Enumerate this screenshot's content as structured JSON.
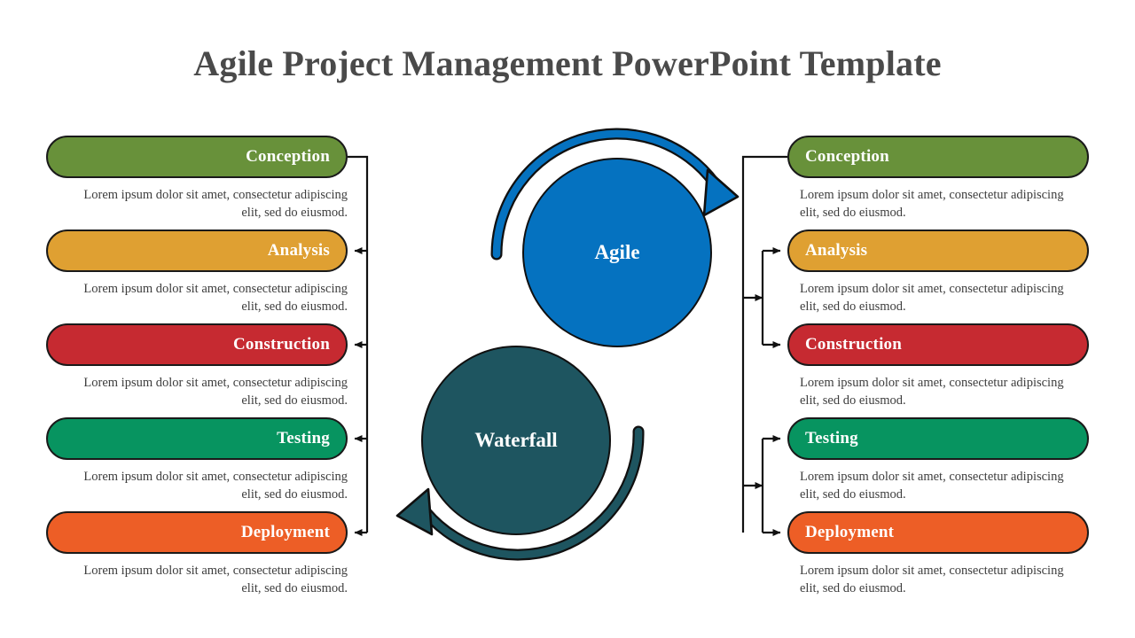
{
  "slide": {
    "title": "Agile Project Management PowerPoint Template",
    "background_color": "#ffffff",
    "title_color": "#4a4a4a"
  },
  "body_text": "Lorem ipsum dolor sit amet, consectetur adipiscing elit, sed do eiusmod.",
  "center": {
    "agile": {
      "label": "Agile",
      "color": "#0572c0",
      "arrow_direction": "clockwise-top"
    },
    "waterfall": {
      "label": "Waterfall",
      "color": "#1e5560",
      "arrow_direction": "counterclockwise-bottom"
    }
  },
  "left_column": {
    "align": "right",
    "items": [
      {
        "label": "Conception",
        "color": "#68913a",
        "desc": "Lorem ipsum dolor sit amet, consectetur adipiscing elit, sed do eiusmod."
      },
      {
        "label": "Analysis",
        "color": "#dfa032",
        "desc": "Lorem ipsum dolor sit amet, consectetur adipiscing elit, sed do eiusmod."
      },
      {
        "label": "Construction",
        "color": "#c62a31",
        "desc": "Lorem ipsum dolor sit amet, consectetur adipiscing elit, sed do eiusmod."
      },
      {
        "label": "Testing",
        "color": "#079460",
        "desc": "Lorem ipsum dolor sit amet, consectetur adipiscing elit, sed do eiusmod."
      },
      {
        "label": "Deployment",
        "color": "#ed5e26",
        "desc": "Lorem ipsum dolor sit amet, consectetur adipiscing elit, sed do eiusmod."
      }
    ]
  },
  "right_column": {
    "align": "left",
    "items": [
      {
        "label": "Conception",
        "color": "#68913a",
        "desc": "Lorem ipsum dolor sit amet, consectetur adipiscing elit, sed do eiusmod."
      },
      {
        "label": "Analysis",
        "color": "#dfa032",
        "desc": "Lorem ipsum dolor sit amet, consectetur adipiscing elit, sed do eiusmod."
      },
      {
        "label": "Construction",
        "color": "#c62a31",
        "desc": "Lorem ipsum dolor sit amet, consectetur adipiscing elit, sed do eiusmod."
      },
      {
        "label": "Testing",
        "color": "#079460",
        "desc": "Lorem ipsum dolor sit amet, consectetur adipiscing elit, sed do eiusmod."
      },
      {
        "label": "Deployment",
        "color": "#ed5e26",
        "desc": "Lorem ipsum dolor sit amet, consectetur adipiscing elit, sed do eiusmod."
      }
    ]
  },
  "connector_color": "#111111"
}
